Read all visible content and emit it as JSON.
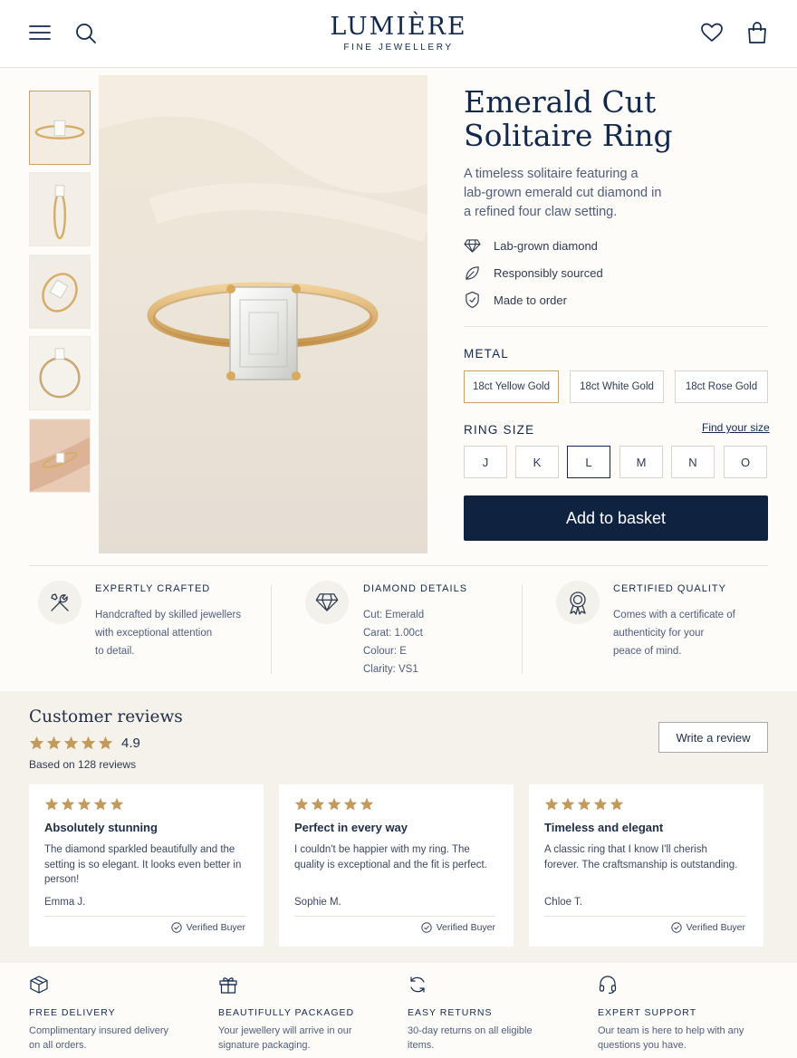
{
  "brand": {
    "name": "LUMIÈRE",
    "tagline": "FINE JEWELLERY"
  },
  "product": {
    "title_line1": "Emerald Cut",
    "title_line2": "Solitaire Ring",
    "description": "A timeless solitaire featuring a lab-grown emerald cut diamond in a refined four claw setting.",
    "features": [
      {
        "icon": "diamond-icon",
        "label": "Lab-grown diamond"
      },
      {
        "icon": "leaf-icon",
        "label": "Responsibly sourced"
      },
      {
        "icon": "shield-check-icon",
        "label": "Made to order"
      }
    ]
  },
  "metal": {
    "label": "METAL",
    "options": [
      "18ct Yellow Gold",
      "18ct White Gold",
      "18ct Rose Gold"
    ],
    "selected": "18ct Yellow Gold"
  },
  "ring_size": {
    "label": "RING SIZE",
    "guide_link": "Find your size",
    "options": [
      "J",
      "K",
      "L",
      "M",
      "N",
      "O"
    ],
    "selected": "L"
  },
  "add_to_basket": "Add to basket",
  "info": [
    {
      "icon": "tools-icon",
      "heading": "EXPERTLY CRAFTED",
      "lines": [
        "Handcrafted by skilled jewellers",
        "with exceptional attention",
        "to detail."
      ]
    },
    {
      "icon": "diamond-icon",
      "heading": "DIAMOND DETAILS",
      "lines": [
        "Cut: Emerald",
        "Carat: 1.00ct",
        "Colour: E",
        "Clarity: VS1"
      ]
    },
    {
      "icon": "award-ribbon-icon",
      "heading": "CERTIFIED QUALITY",
      "lines": [
        "Comes with a certificate of",
        "authenticity for your",
        "peace of mind."
      ]
    }
  ],
  "reviews": {
    "title": "Customer reviews",
    "rating": "4.9",
    "count_text": "Based on 128 reviews",
    "write_button": "Write a review",
    "items": [
      {
        "title": "Absolutely stunning",
        "body": "The diamond sparkled beautifully and the setting is so elegant. It looks even better in person!",
        "author": "Emma J.",
        "badge": "Verified Buyer",
        "stars": 5
      },
      {
        "title": "Perfect in every way",
        "body": "I couldn't be happier with my ring. The quality is exceptional and the fit is perfect.",
        "author": "Sophie M.",
        "badge": "Verified Buyer",
        "stars": 5
      },
      {
        "title": "Timeless and elegant",
        "body": "A classic ring that I know I'll cherish forever. The craftsmanship is outstanding.",
        "author": "Chloe T.",
        "badge": "Verified Buyer",
        "stars": 5
      }
    ]
  },
  "footer": [
    {
      "icon": "box-icon",
      "heading": "FREE DELIVERY",
      "lines": [
        "Complimentary insured delivery",
        "on all orders."
      ]
    },
    {
      "icon": "gift-icon",
      "heading": "BEAUTIFULLY PACKAGED",
      "lines": [
        "Your jewellery will arrive in our",
        "signature packaging."
      ]
    },
    {
      "icon": "returns-icon",
      "heading": "EASY RETURNS",
      "lines": [
        "30-day returns on all eligible",
        "items."
      ]
    },
    {
      "icon": "headset-icon",
      "heading": "EXPERT SUPPORT",
      "lines": [
        "Our team is here to help with any",
        "questions you have."
      ]
    }
  ],
  "colors": {
    "navy": "#0f2341",
    "gold": "#c9a06a",
    "star": "#c29a5c",
    "bg": "#fdfcf9"
  }
}
